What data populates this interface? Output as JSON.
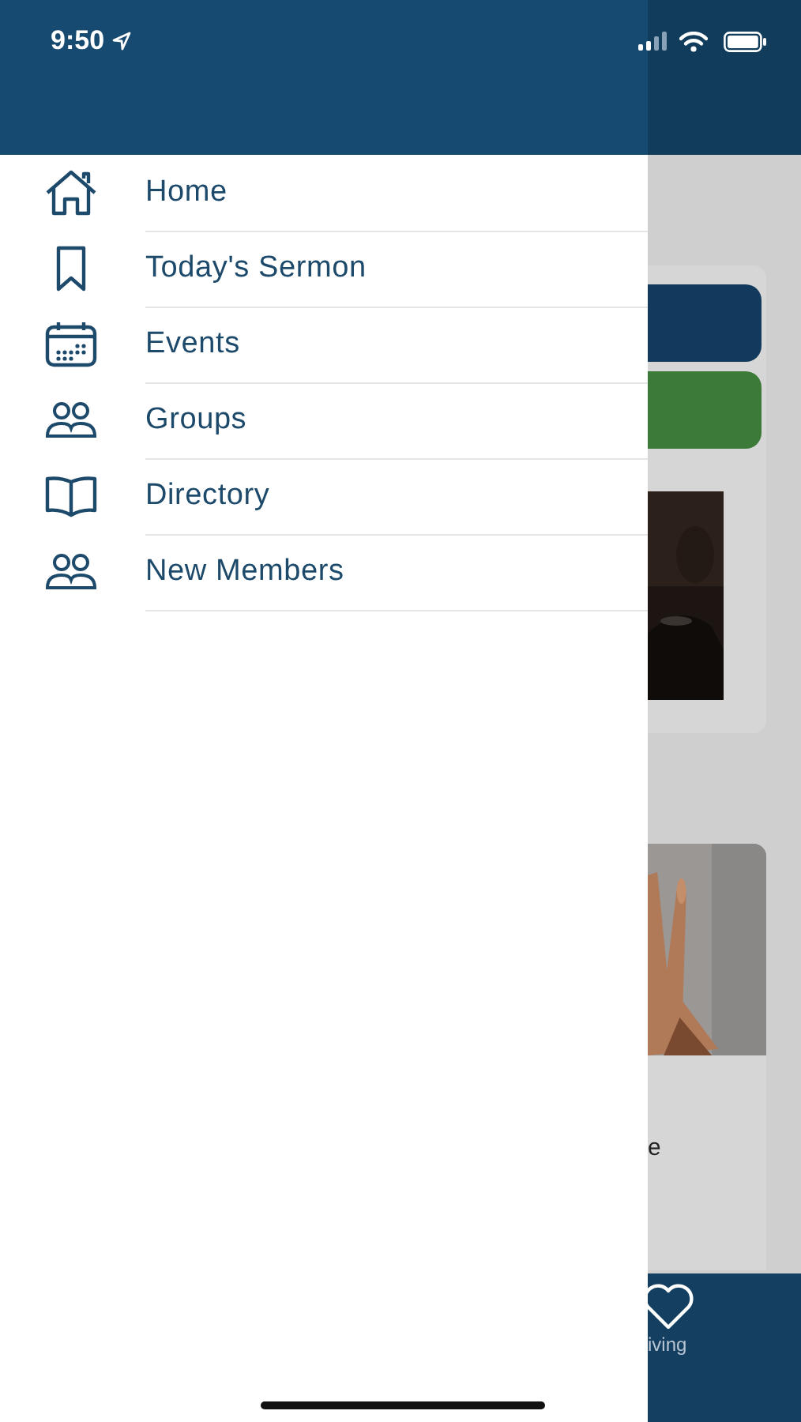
{
  "status_bar": {
    "time": "9:50"
  },
  "menu": {
    "items": [
      {
        "label": "Home",
        "kind": "home"
      },
      {
        "label": "Today's Sermon",
        "kind": "bookmark"
      },
      {
        "label": "Events",
        "kind": "calendar"
      },
      {
        "label": "Groups",
        "kind": "people"
      },
      {
        "label": "Directory",
        "kind": "book"
      },
      {
        "label": "New Members",
        "kind": "people"
      }
    ]
  },
  "background": {
    "card_text": "e",
    "tab_label": "iving"
  }
}
